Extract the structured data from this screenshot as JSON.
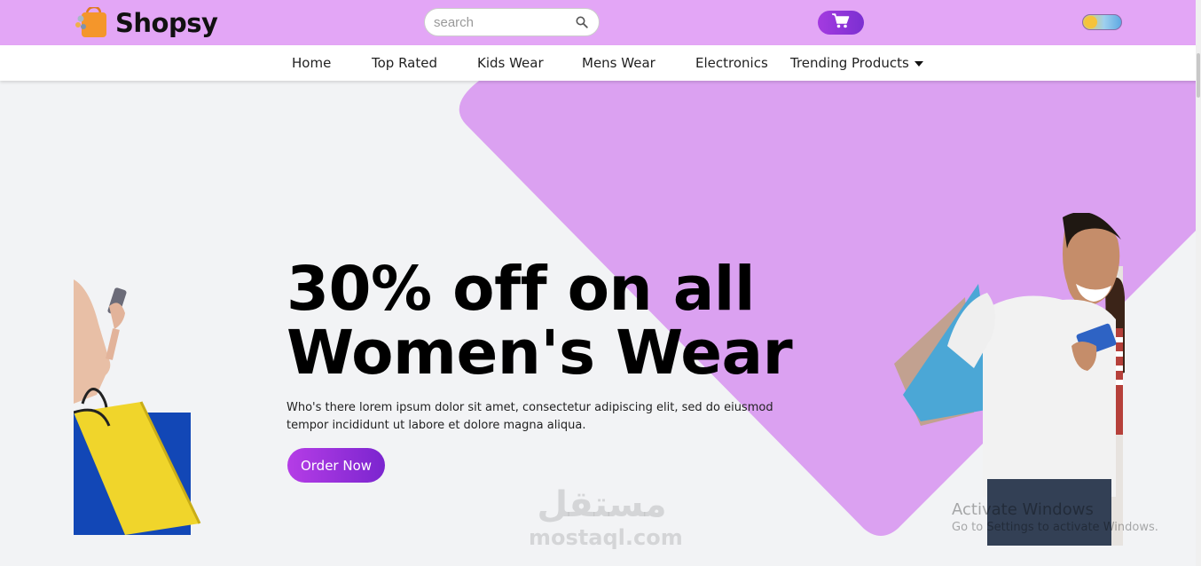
{
  "header": {
    "brand": "Shopsy",
    "search_placeholder": "search"
  },
  "nav": {
    "items": [
      {
        "label": "Home"
      },
      {
        "label": "Top Rated"
      },
      {
        "label": "Kids Wear"
      },
      {
        "label": "Mens Wear"
      },
      {
        "label": "Electronics"
      },
      {
        "label": "Trending Products"
      }
    ]
  },
  "hero": {
    "headline_line1": "30% off on all",
    "headline_line2": "Women's Wear",
    "description": "Who's there lorem ipsum dolor sit amet, consectetur adipiscing elit, sed do eiusmod tempor incididunt ut labore et dolore magna aliqua.",
    "cta_label": "Order Now"
  },
  "watermark": {
    "arabic": "مستقل",
    "latin": "mostaql.com"
  },
  "os_overlay": {
    "title": "Activate Windows",
    "subtitle": "Go to Settings to activate Windows."
  },
  "colors": {
    "header_bg": "#e3a6f6",
    "hero_shape": "#dba1f1",
    "accent": "#a43be0"
  },
  "icons": [
    "shopping-bag-logo-icon",
    "search-icon",
    "cart-icon",
    "sun-icon"
  ]
}
